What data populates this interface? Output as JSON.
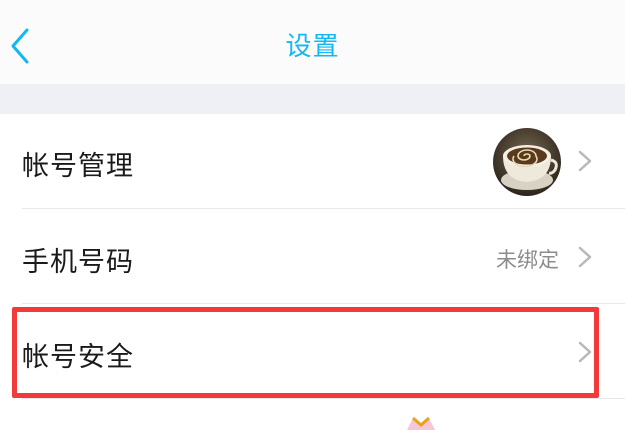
{
  "header": {
    "title": "设置",
    "back_icon": "chevron-left-icon"
  },
  "settings": [
    {
      "id": "account-management",
      "label": "帐号管理",
      "value": "",
      "icon": "chevron-right-icon"
    },
    {
      "id": "phone-number",
      "label": "手机号码",
      "value": "未绑定",
      "icon": "chevron-right-icon"
    },
    {
      "id": "account-security",
      "label": "帐号安全",
      "value": "",
      "icon": "chevron-right-icon"
    }
  ],
  "avatar_icon": "coffee-cup-avatar-icon",
  "colors": {
    "accent": "#12b7f5",
    "highlight": "#f23a3a",
    "gap": "#eef0f5"
  }
}
